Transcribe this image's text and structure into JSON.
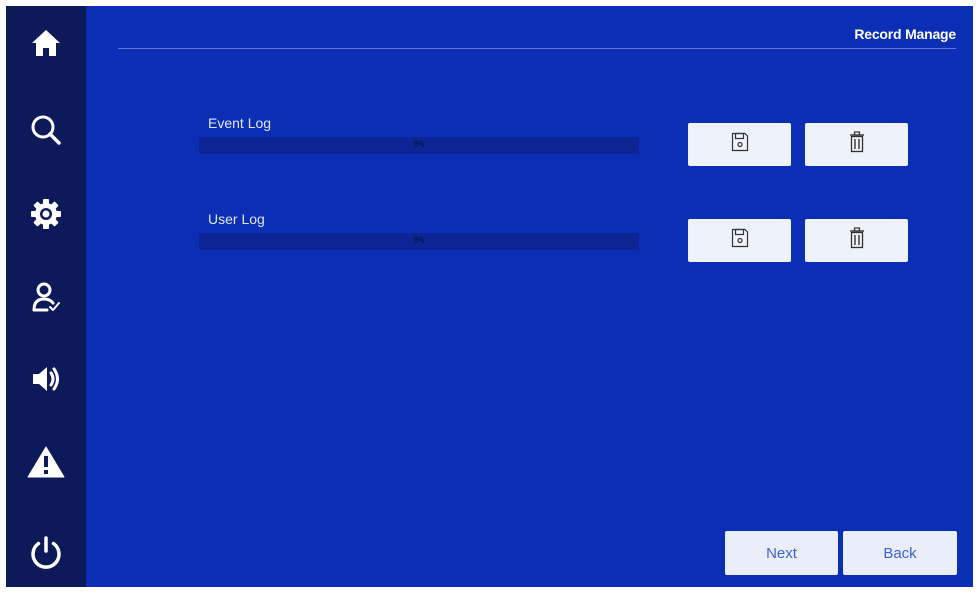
{
  "sidebar": {
    "items": [
      {
        "icon": "home-icon"
      },
      {
        "icon": "search-icon"
      },
      {
        "icon": "gear-icon"
      },
      {
        "icon": "user-check-icon"
      },
      {
        "icon": "speaker-icon"
      },
      {
        "icon": "warning-icon"
      },
      {
        "icon": "power-icon"
      }
    ]
  },
  "header": {
    "title": "Record Manage"
  },
  "logs": [
    {
      "label": "Event Log",
      "progress_text": "0%",
      "progress": 0
    },
    {
      "label": "User Log",
      "progress_text": "0%",
      "progress": 0
    }
  ],
  "footer": {
    "next_label": "Next",
    "back_label": "Back"
  },
  "colors": {
    "background": "#0a2fb4",
    "sidebar": "#0c1a5a",
    "button": "#edf2fb",
    "button_text": "#3d63d3"
  }
}
